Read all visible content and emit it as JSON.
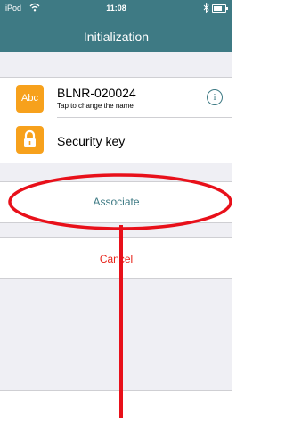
{
  "status_bar": {
    "carrier": "iPod",
    "wifi_icon": "wifi-icon",
    "time": "11:08",
    "bluetooth_icon": "bluetooth-icon",
    "battery_icon": "battery-icon"
  },
  "nav": {
    "title": "Initialization",
    "background": "#3e7a84"
  },
  "device": {
    "tile_text": "Abc",
    "name": "BLNR-020024",
    "subtitle": "Tap to change the name",
    "info_icon": "info-icon",
    "info_glyph": "i"
  },
  "security": {
    "label": "Security key",
    "icon": "lock-icon"
  },
  "actions": {
    "associate": "Associate",
    "cancel": "Cancel"
  },
  "annotation": {
    "color": "#e8101a"
  }
}
